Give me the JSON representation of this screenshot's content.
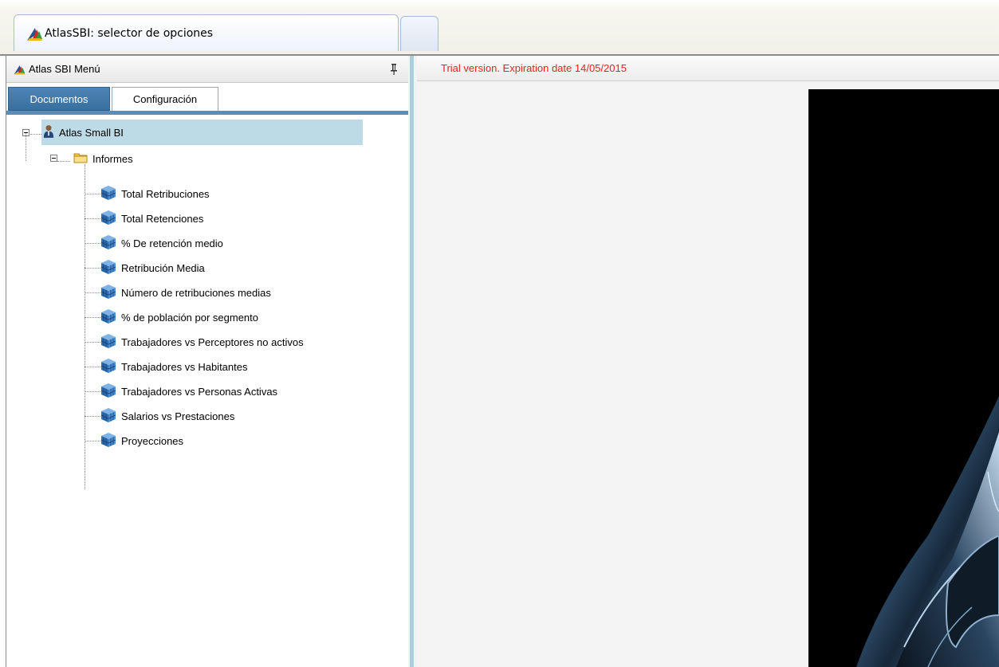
{
  "window": {
    "tab_title": "AtlasSBI: selector de opciones"
  },
  "left_panel": {
    "title": "Atlas SBI Menú",
    "tabs": [
      "Documentos",
      "Configuración"
    ],
    "active_tab": "Documentos",
    "tree": {
      "root": "Atlas Small BI",
      "folder": "Informes",
      "reports": [
        "Total Retribuciones",
        "Total Retenciones",
        "% De retención medio",
        "Retribución Media",
        "Número de retribuciones medias",
        "% de población por segmento",
        "Trabajadores vs Perceptores no activos",
        "Trabajadores vs Habitantes",
        "Trabajadores vs Personas Activas",
        "Salarios vs Prestaciones",
        "Proyecciones"
      ]
    }
  },
  "content": {
    "trial_notice": "Trial version. Expiration date 14/05/2015"
  },
  "colors": {
    "trial_text": "#e8231e",
    "active_tab": "#4478a8",
    "selection": "#bcdbe6",
    "splitter": "#a9d0da"
  },
  "icons": {
    "app": "atlas-brush-icon",
    "pin": "pin-icon",
    "root": "user-icon",
    "folder": "folder-icon",
    "report": "cube-icon"
  }
}
